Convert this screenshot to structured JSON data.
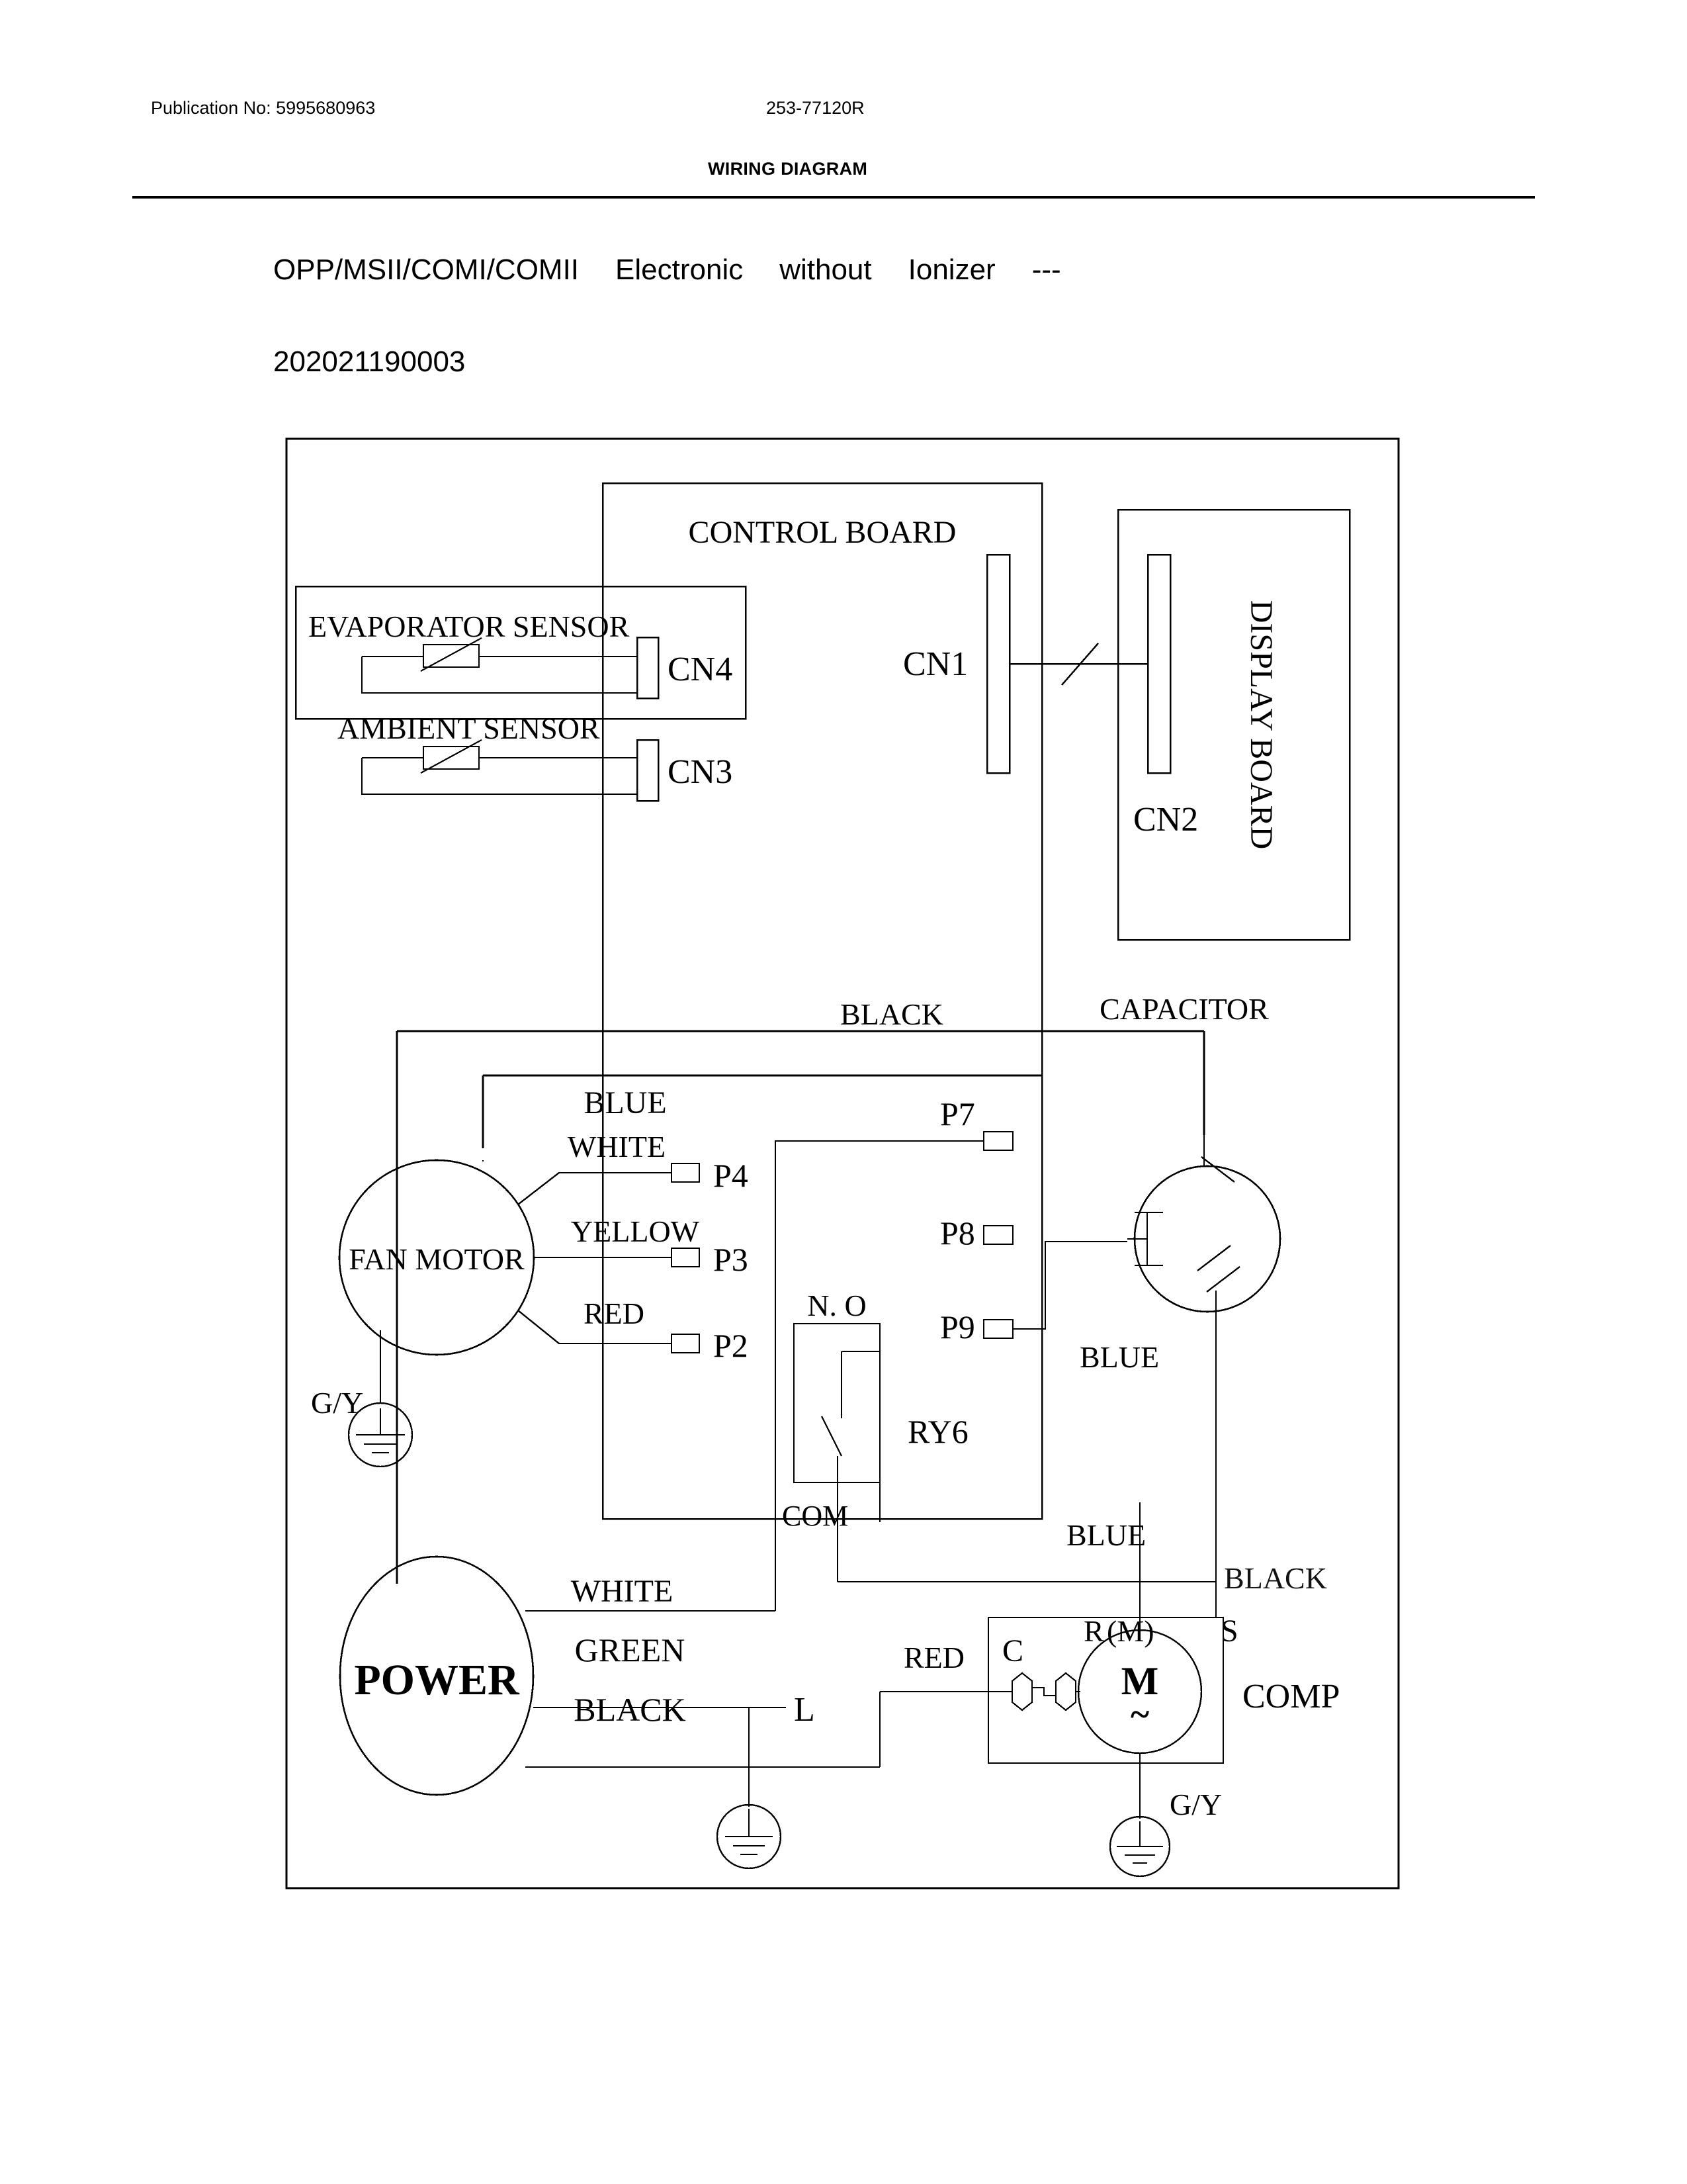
{
  "header": {
    "publication": "Publication No: 5995680963",
    "model_number": "253-77120R",
    "title": "WIRING DIAGRAM"
  },
  "subtitle": {
    "part1": "OPP/MSII/COMI/COMII",
    "part2": "Electronic",
    "part3": "without",
    "part4": "Ionizer",
    "part5": "---",
    "code": "202021190003"
  },
  "diagram": {
    "control_board_label": "CONTROL  BOARD",
    "display_board_label": "DISPLAY BOARD",
    "evaporator_sensor_label": "EVAPORATOR SENSOR",
    "ambient_sensor_label": "AMBIENT SENSOR",
    "connectors": {
      "cn4": "CN4",
      "cn3": "CN3",
      "cn1": "CN1",
      "cn2": "CN2"
    },
    "fan_motor_label": "FAN MOTOR",
    "power_label": "POWER",
    "capacitor_label": "CAPACITOR",
    "compressor_label": "COMP",
    "relay_label": "RY6",
    "relay_no": "N. O",
    "relay_com": "COM",
    "terminals": {
      "p7": "P7",
      "p8": "P8",
      "p9": "P9",
      "p4": "P4",
      "p3": "P3",
      "p2": "P2"
    },
    "compressor_terminals": {
      "c": "C",
      "r": "R",
      "m": "(M)",
      "s": "S",
      "motor": "M",
      "motor_ac": "~"
    },
    "line_label": "L",
    "wire_labels": {
      "black_top": "BLACK",
      "blue_fan": "BLUE",
      "white_fan": "WHITE",
      "yellow_fan": "YELLOW",
      "red_fan": "RED",
      "blue_cap": "BLUE",
      "blue_comp": "BLUE",
      "black_comp": "BLACK",
      "red_comp": "RED",
      "white_power": "WHITE",
      "green_power": "GREEN",
      "black_power": "BLACK"
    },
    "ground_labels": {
      "fan_ground": "G/Y",
      "comp_ground": "G/Y"
    }
  },
  "colors": {
    "ink": "#000000",
    "paper": "#ffffff"
  }
}
